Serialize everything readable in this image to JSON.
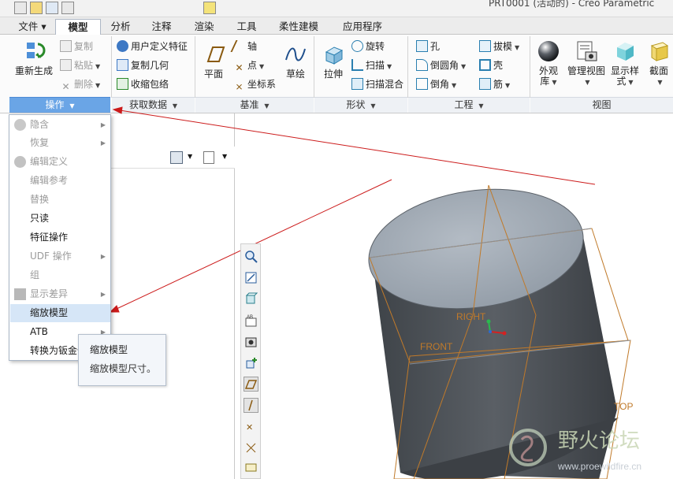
{
  "window": {
    "title": "PRT0001 (活动的) - Creo Parametric"
  },
  "tabs": [
    {
      "label": "文件 ▾"
    },
    {
      "label": "模型"
    },
    {
      "label": "分析"
    },
    {
      "label": "注释"
    },
    {
      "label": "渲染"
    },
    {
      "label": "工具"
    },
    {
      "label": "柔性建模"
    },
    {
      "label": "应用程序"
    }
  ],
  "active_tab": "模型",
  "ribbon": {
    "operations": {
      "regenerate": "重新生成",
      "copy": "复制",
      "paste": "粘贴",
      "delete": "删除",
      "group_label": "操作"
    },
    "get_data": {
      "user_feature": "用户定义特征",
      "copy_geometry": "复制几何",
      "shrinkwrap": "收缩包络",
      "group_label": "获取数据"
    },
    "datum": {
      "plane": "平面",
      "axis": "轴",
      "point": "点",
      "csys": "坐标系",
      "sketch": "草绘",
      "group_label": "基准"
    },
    "shapes": {
      "extrude": "拉伸",
      "revolve": "旋转",
      "sweep": "扫描",
      "swept_blend": "扫描混合",
      "group_label": "形状"
    },
    "engineering": {
      "hole": "孔",
      "round": "倒圆角",
      "chamfer": "倒角",
      "draft": "拔模",
      "shell": "壳",
      "rib": "筋",
      "group_label": "工程"
    },
    "view": {
      "appearance_1": "外观",
      "appearance_2": "库",
      "manage_views": "管理视图",
      "display_style_1": "显示样",
      "display_style_2": "式",
      "section": "截面",
      "group_label": "视图"
    }
  },
  "operations_menu": [
    {
      "label": "隐含",
      "disabled": true,
      "submenu": true,
      "icon": "suppress-icon"
    },
    {
      "label": "恢复",
      "disabled": true,
      "submenu": true
    },
    {
      "label": "编辑定义",
      "disabled": true,
      "submenu": false,
      "icon": "edit-definition-icon"
    },
    {
      "label": "编辑参考",
      "disabled": true,
      "submenu": false
    },
    {
      "label": "替换",
      "disabled": true,
      "submenu": false
    },
    {
      "label": "只读",
      "disabled": false,
      "submenu": false
    },
    {
      "label": "特征操作",
      "disabled": false,
      "submenu": false
    },
    {
      "label": "UDF 操作",
      "disabled": true,
      "submenu": true
    },
    {
      "label": "组",
      "disabled": true,
      "submenu": false
    },
    {
      "label": "显示差异",
      "disabled": true,
      "submenu": true,
      "icon": "show-difference-icon"
    },
    {
      "label": "缩放模型",
      "disabled": false,
      "submenu": false,
      "highlighted": true
    },
    {
      "label": "ATB",
      "disabled": false,
      "submenu": true
    },
    {
      "label": "转换为钣金件",
      "disabled": false,
      "submenu": false
    }
  ],
  "tooltip": {
    "title": "缩放模型",
    "description": "缩放模型尺寸。"
  },
  "model_view": {
    "datum_labels": {
      "right": "RIGHT",
      "front": "FRONT",
      "top": "TOP"
    }
  },
  "colors": {
    "datum_plane": "#c07a2a",
    "annotation_arrow": "#cc1b1b",
    "accent": "#6aa5e6",
    "model_side": "#4e5358",
    "model_top": "#a0a8b2"
  },
  "watermark": {
    "text": "野火论坛",
    "url": "www.proewildfire.cn"
  }
}
